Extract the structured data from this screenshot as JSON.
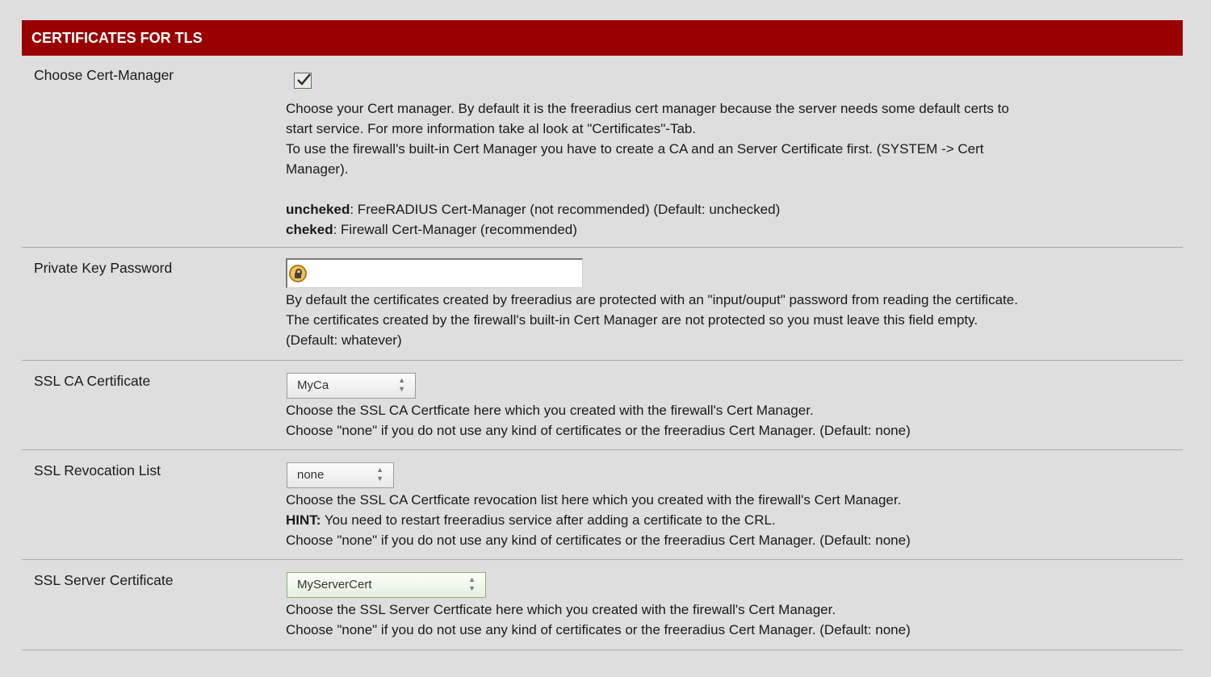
{
  "section": {
    "title": "CERTIFICATES FOR TLS"
  },
  "rows": {
    "cert_manager": {
      "label": "Choose Cert-Manager",
      "checked": true,
      "desc_line1": "Choose your Cert manager. By default it is the freeradius cert manager because the server needs some default certs to",
      "desc_line2": "start service. For more information take al look at \"Certificates\"-Tab.",
      "desc_line3": "To use the firewall's built-in Cert Manager you have to create a CA and an Server Certificate first. (SYSTEM -> Cert",
      "desc_line4": "Manager).",
      "unchecked_key": "uncheked",
      "unchecked_text": ": FreeRADIUS Cert-Manager (not recommended) (Default: unchecked)",
      "checked_key": "cheked",
      "checked_text": ": Firewall Cert-Manager (recommended)"
    },
    "private_key": {
      "label": "Private Key Password",
      "value": "",
      "desc_line1": "By default the certificates created by freeradius are protected with an \"input/ouput\" password from reading the certificate.",
      "desc_line2": "The certificates created by the firewall's built-in Cert Manager are not protected so you must leave this field empty.",
      "desc_line3": "(Default: whatever)"
    },
    "ssl_ca": {
      "label": "SSL CA Certificate",
      "selected": "MyCa",
      "desc_line1": "Choose the SSL CA Certficate here which you created with the firewall's Cert Manager.",
      "desc_line2": "Choose \"none\" if you do not use any kind of certificates or the freeradius Cert Manager. (Default: none)"
    },
    "ssl_crl": {
      "label": "SSL Revocation List",
      "selected": "none",
      "desc_line1": "Choose the SSL CA Certficate revocation list here which you created with the firewall's Cert Manager.",
      "hint_key": "HINT:",
      "hint_text": " You need to restart freeradius service after adding a certificate to the CRL.",
      "desc_line3": "Choose \"none\" if you do not use any kind of certificates or the freeradius Cert Manager. (Default: none)"
    },
    "ssl_server": {
      "label": "SSL Server Certificate",
      "selected": "MyServerCert",
      "desc_line1": "Choose the SSL Server Certficate here which you created with the firewall's Cert Manager.",
      "desc_line2": "Choose \"none\" if you do not use any kind of certificates or the freeradius Cert Manager. (Default: none)"
    }
  }
}
